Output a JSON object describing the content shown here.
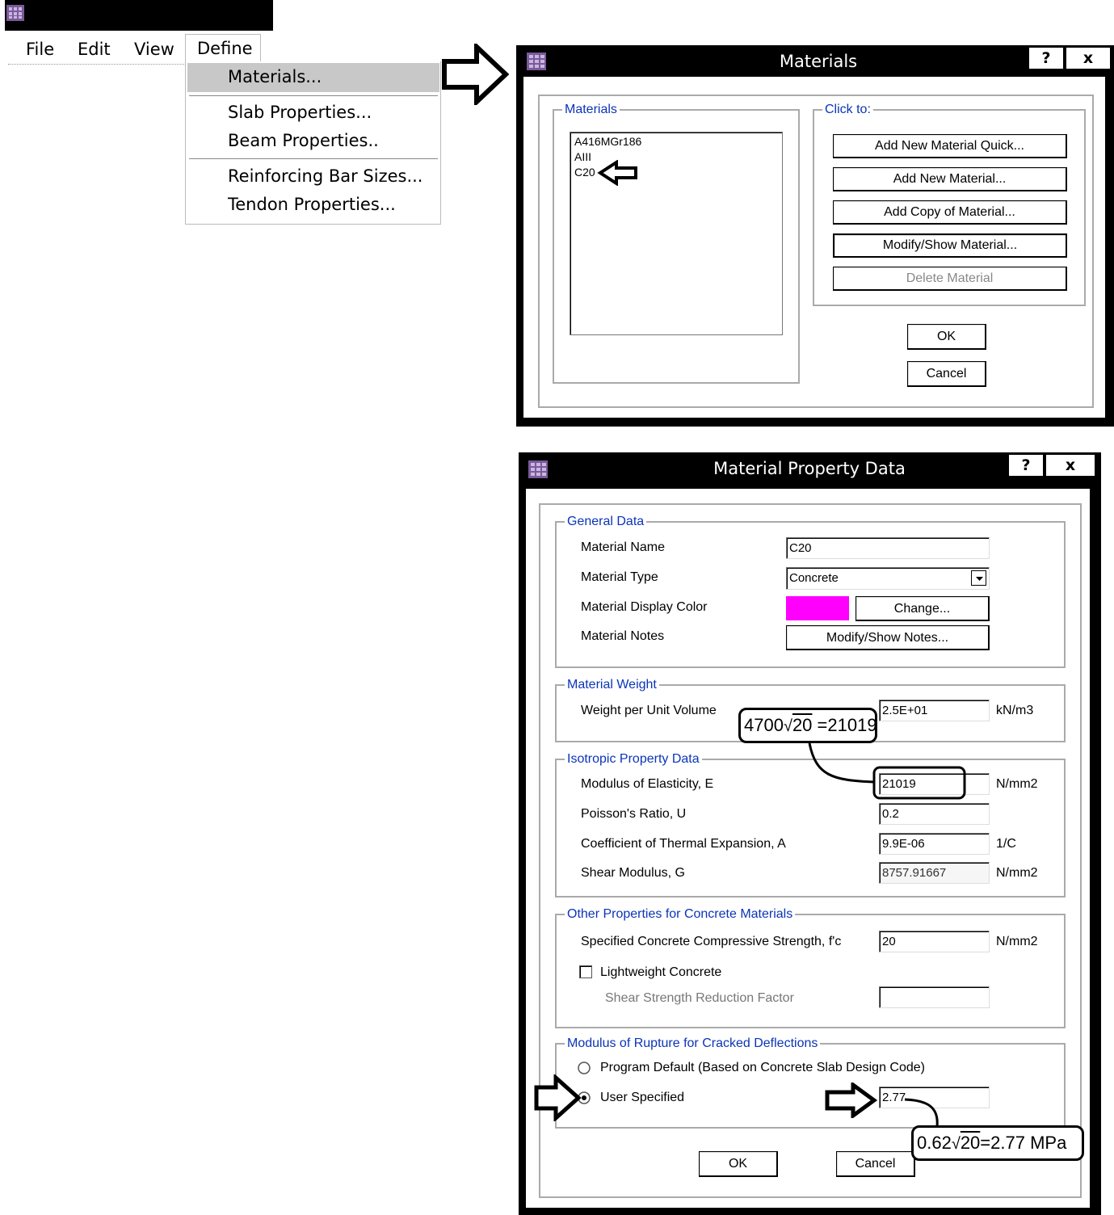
{
  "menubar": {
    "file": "File",
    "edit": "Edit",
    "view": "View",
    "define": "Define",
    "define_menu": [
      "Materials...",
      "Slab Properties...",
      "Beam Properties..",
      "Reinforcing Bar Sizes...",
      "Tendon Properties..."
    ]
  },
  "materials_dialog": {
    "title": "Materials",
    "help": "?",
    "close": "x",
    "list_group": "Materials",
    "list_items": [
      "A416MGr186",
      "AIII",
      "C20"
    ],
    "click_group": "Click to:",
    "buttons": [
      "Add New Material Quick...",
      "Add New Material...",
      "Add Copy of Material...",
      "Modify/Show Material...",
      "Delete Material"
    ],
    "ok": "OK",
    "cancel": "Cancel"
  },
  "property_dialog": {
    "title": "Material Property Data",
    "help": "?",
    "close": "x",
    "general": {
      "label": "General Data",
      "name_label": "Material Name",
      "name_value": "C20",
      "type_label": "Material Type",
      "type_value": "Concrete",
      "color_label": "Material Display Color",
      "color_value": "#ff00ff",
      "change": "Change...",
      "notes_label": "Material Notes",
      "notes_button": "Modify/Show Notes..."
    },
    "weight": {
      "label": "Material Weight",
      "wpuv_label": "Weight per Unit Volume",
      "wpuv_value": "2.5E+01",
      "wpuv_unit": "kN/m3"
    },
    "isotropic": {
      "label": "Isotropic Property Data",
      "e_label": "Modulus of Elasticity,  E",
      "e_value": "21019",
      "e_unit": "N/mm2",
      "u_label": "Poisson's Ratio,  U",
      "u_value": "0.2",
      "a_label": "Coefficient of Thermal Expansion,  A",
      "a_value": "9.9E-06",
      "a_unit": "1/C",
      "g_label": "Shear Modulus,  G",
      "g_value": "8757.91667",
      "g_unit": "N/mm2"
    },
    "concrete": {
      "label": "Other Properties for Concrete Materials",
      "fc_label": "Specified Concrete Compressive Strength, f'c",
      "fc_value": "20",
      "fc_unit": "N/mm2",
      "lw_label": "Lightweight Concrete",
      "ssrf_label": "Shear Strength Reduction Factor",
      "ssrf_value": ""
    },
    "rupture": {
      "label": "Modulus of Rupture for Cracked Deflections",
      "default_label": "Program Default  (Based on Concrete Slab Design Code)",
      "user_label": "User Specified",
      "user_value": "2.77"
    },
    "ok": "OK",
    "cancel": "Cancel"
  },
  "annotations": {
    "e_formula_prefix": "4700",
    "e_formula_radicand": "20",
    "e_formula_suffix": " =21019",
    "fr_formula_prefix": "0.62",
    "fr_formula_radicand": "20",
    "fr_formula_suffix": "=2.77 MPa"
  }
}
